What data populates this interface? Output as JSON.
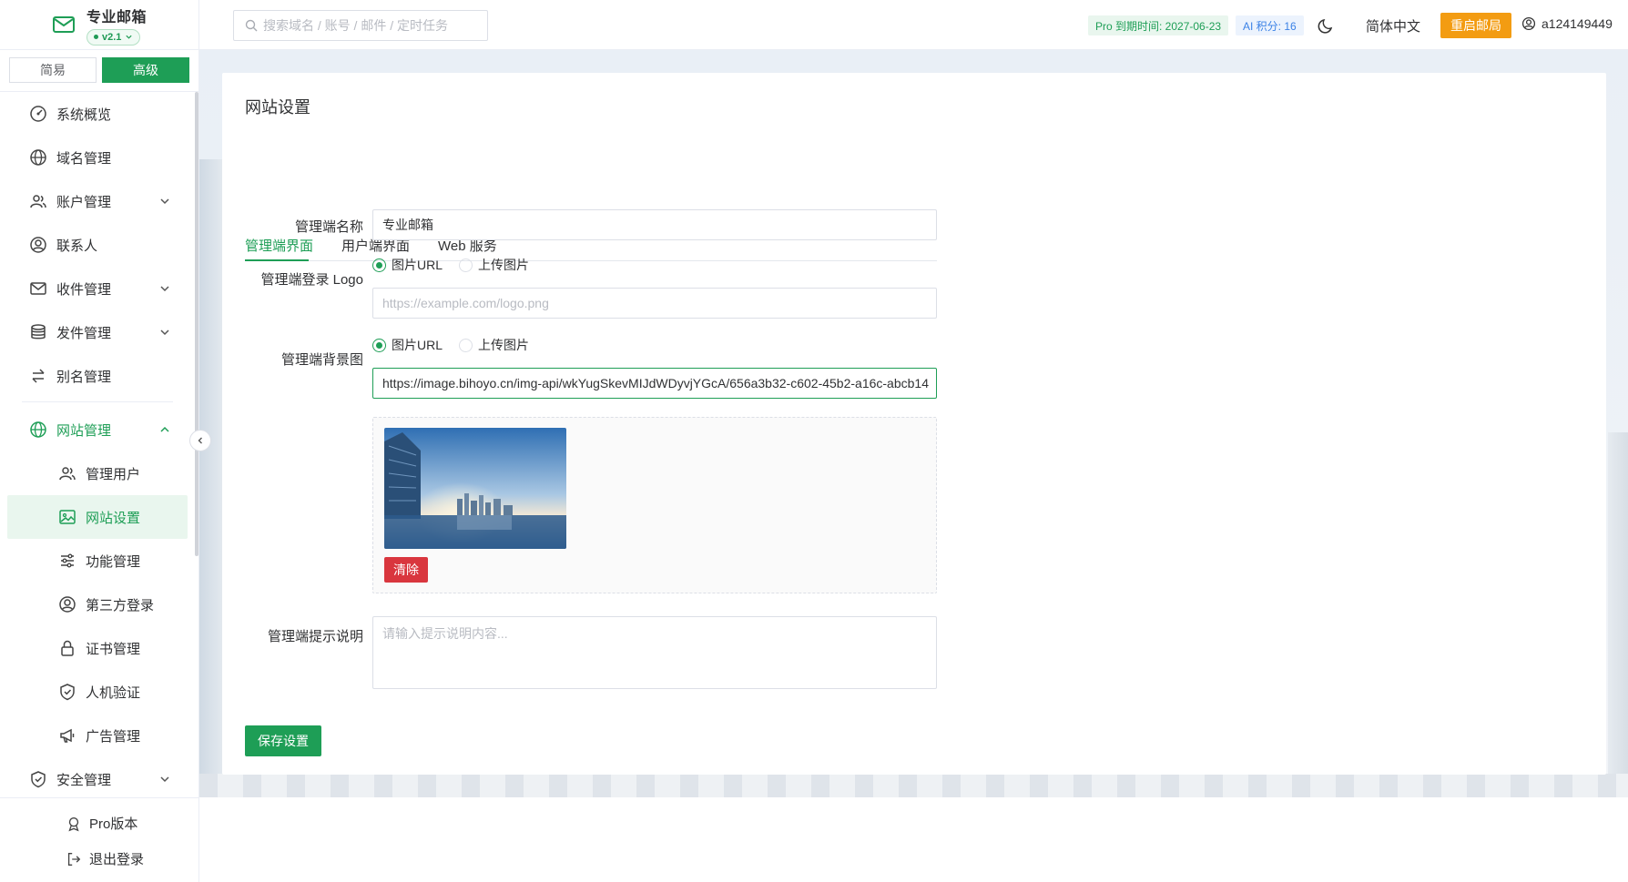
{
  "brand": {
    "title": "专业邮箱",
    "version": "v2.1"
  },
  "mode": {
    "simple": "简易",
    "advanced": "高级"
  },
  "menu": {
    "overview": "系统概览",
    "domain": "域名管理",
    "accounts": "账户管理",
    "contacts": "联系人",
    "inbox": "收件管理",
    "send": "发件管理",
    "alias": "别名管理",
    "website": "网站管理",
    "sub": {
      "admin_users": "管理用户",
      "site_settings": "网站设置",
      "features": "功能管理",
      "third_party": "第三方登录",
      "certs": "证书管理",
      "captcha": "人机验证",
      "ads": "广告管理"
    },
    "security": "安全管理"
  },
  "bottom": {
    "pro": "Pro版本",
    "logout": "退出登录"
  },
  "header": {
    "search_placeholder": "搜索域名 / 账号 / 邮件 / 定时任务",
    "pro_tag": "Pro 到期时间: 2027-06-23",
    "ai_tag": "AI 积分: 16",
    "language": "简体中文",
    "restart": "重启邮局",
    "username": "a124149449"
  },
  "page": {
    "title": "网站设置",
    "tabs": [
      "管理端界面",
      "用户端界面",
      "Web 服务"
    ],
    "active_tab": 0,
    "fields": {
      "admin_name_label": "管理端名称",
      "admin_name_value": "专业邮箱",
      "logo_label": "管理端登录 Logo",
      "logo_options": [
        "图片URL",
        "上传图片"
      ],
      "logo_placeholder": "https://example.com/logo.png",
      "bg_label": "管理端背景图",
      "bg_options": [
        "图片URL",
        "上传图片"
      ],
      "bg_value": "https://image.bihoyo.cn/img-api/wkYugSkevMIJdWDyvjYGcA/656a3b32-c602-45b2-a16c-abcb14",
      "clear": "清除",
      "tip_label": "管理端提示说明",
      "tip_placeholder": "请输入提示说明内容..."
    },
    "save": "保存设置"
  },
  "colors": {
    "primary": "#1e9e56",
    "warning": "#f39c12",
    "danger": "#d9363e",
    "info": "#3b82e6"
  }
}
